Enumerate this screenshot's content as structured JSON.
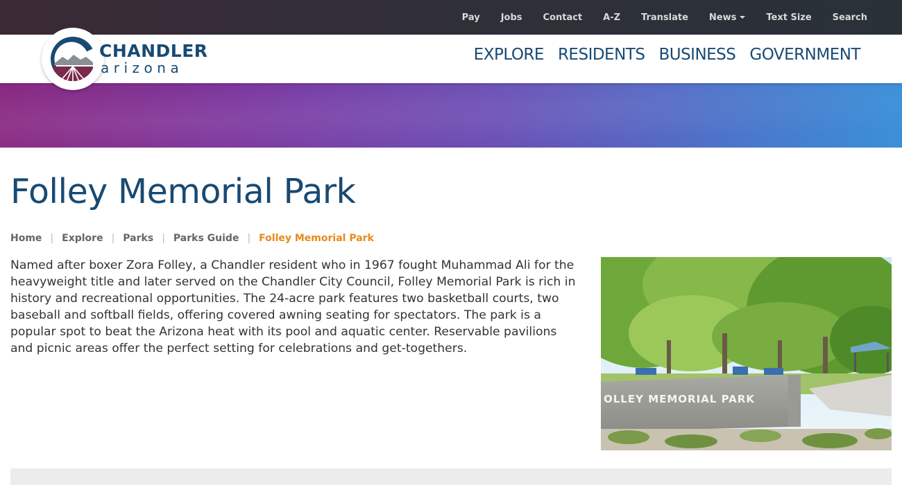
{
  "utility_nav": {
    "items": [
      {
        "label": "Pay"
      },
      {
        "label": "Jobs"
      },
      {
        "label": "Contact"
      },
      {
        "label": "A-Z"
      },
      {
        "label": "Translate"
      },
      {
        "label": "News",
        "has_dropdown": true
      },
      {
        "label": "Text Size"
      },
      {
        "label": "Search"
      }
    ]
  },
  "logo": {
    "line1": "CHANDLER",
    "line2": "arizona"
  },
  "main_nav": {
    "items": [
      {
        "label": "EXPLORE"
      },
      {
        "label": "RESIDENTS"
      },
      {
        "label": "BUSINESS"
      },
      {
        "label": "GOVERNMENT"
      }
    ]
  },
  "page": {
    "title": "Folley Memorial Park",
    "breadcrumb": [
      {
        "label": "Home"
      },
      {
        "label": "Explore"
      },
      {
        "label": "Parks"
      },
      {
        "label": "Parks Guide"
      },
      {
        "label": "Folley Memorial Park",
        "current": true
      }
    ],
    "description": "Named after boxer Zora Folley, a Chandler resident who in 1967 fought Muhammad Ali for the heavyweight title and later served on the Chandler City Council, Folley Memorial Park is rich in history and recreational opportunities. The 24-acre park features two basketball courts, two baseball and softball fields, offering covered awning seating for spectators. The park is a popular spot to beat the Arizona heat with its pool and aquatic center. Reservable pavilions and picnic areas offer the perfect setting for celebrations and get-togethers.",
    "photo_sign_text": "OLLEY MEMORIAL PARK"
  },
  "colors": {
    "brand_blue": "#184a73",
    "breadcrumb_active": "#e88a1a",
    "logo_maroon": "#7a2a4a"
  }
}
